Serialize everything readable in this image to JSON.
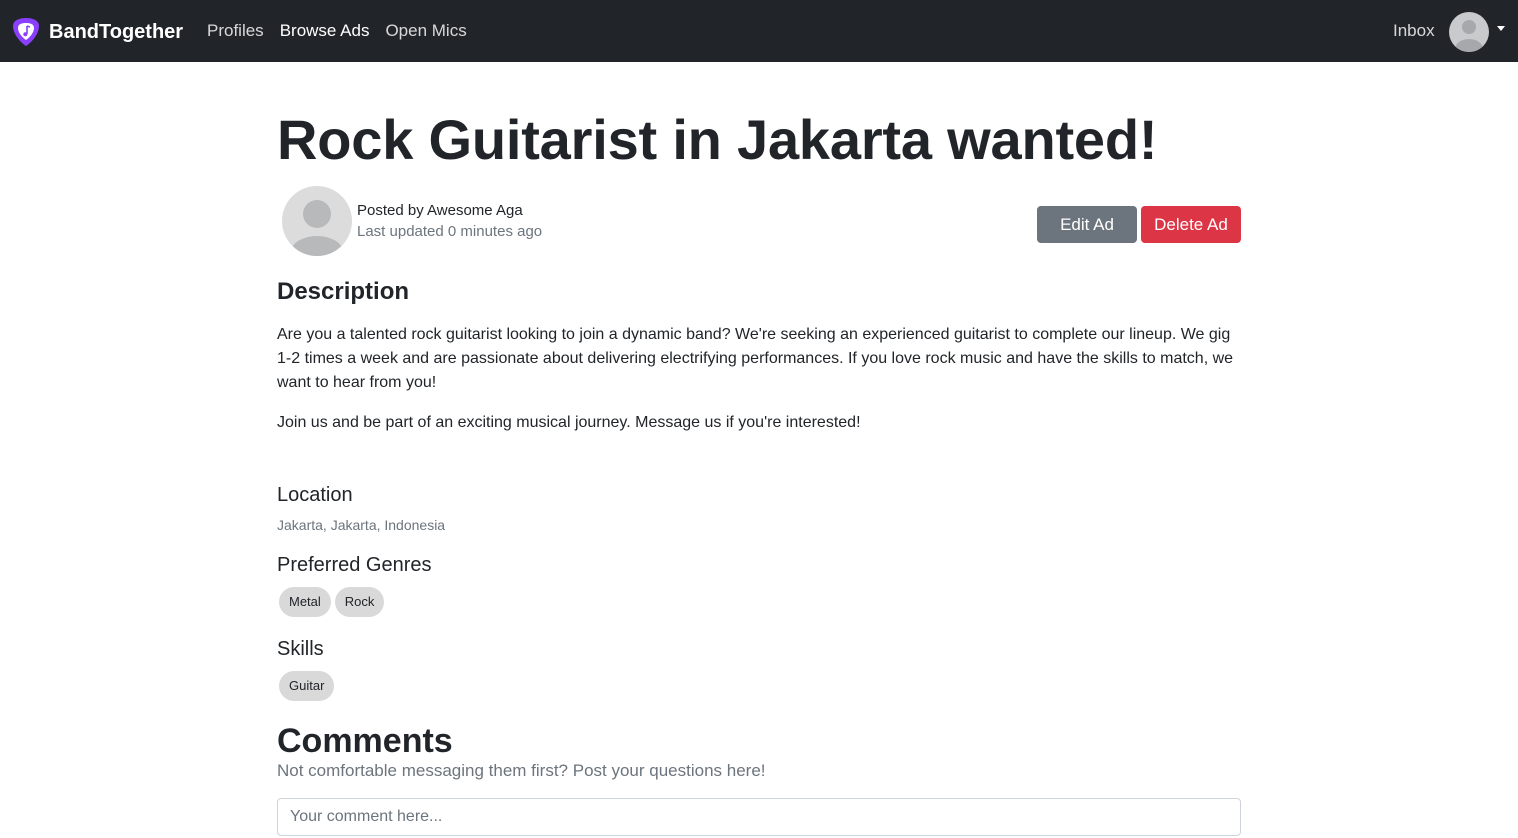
{
  "nav": {
    "brand": "BandTogether",
    "links": [
      "Profiles",
      "Browse Ads",
      "Open Mics"
    ],
    "inbox": "Inbox"
  },
  "ad": {
    "title": "Rock Guitarist in Jakarta wanted!",
    "posted_by": "Posted by Awesome Aga",
    "last_updated": "Last updated 0 minutes ago",
    "edit_label": "Edit Ad",
    "delete_label": "Delete Ad",
    "description_heading": "Description",
    "description": [
      "Are you a talented rock guitarist looking to join a dynamic band? We're seeking an experienced guitarist to complete our lineup. We gig 1-2 times a week and are passionate about delivering electrifying performances. If you love rock music and have the skills to match, we want to hear from you!",
      "Join us and be part of an exciting musical journey. Message us if you're interested!"
    ],
    "location_heading": "Location",
    "location": "Jakarta, Jakarta, Indonesia",
    "genres_heading": "Preferred Genres",
    "genres": [
      "Metal",
      "Rock"
    ],
    "skills_heading": "Skills",
    "skills": [
      "Guitar"
    ]
  },
  "comments": {
    "heading": "Comments",
    "subtitle": "Not comfortable messaging them first? Post your questions here!",
    "placeholder": "Your comment here..."
  },
  "colors": {
    "navbar": "#212529",
    "brand_logo": "#8a3ffc",
    "edit_button": "#6c757d",
    "delete_button": "#dc3545",
    "chip": "#d9d9d9"
  },
  "icons": {
    "brand": "guitar-pick-logo-icon",
    "avatar": "default-user-icon",
    "dropdown": "caret-down-icon"
  }
}
